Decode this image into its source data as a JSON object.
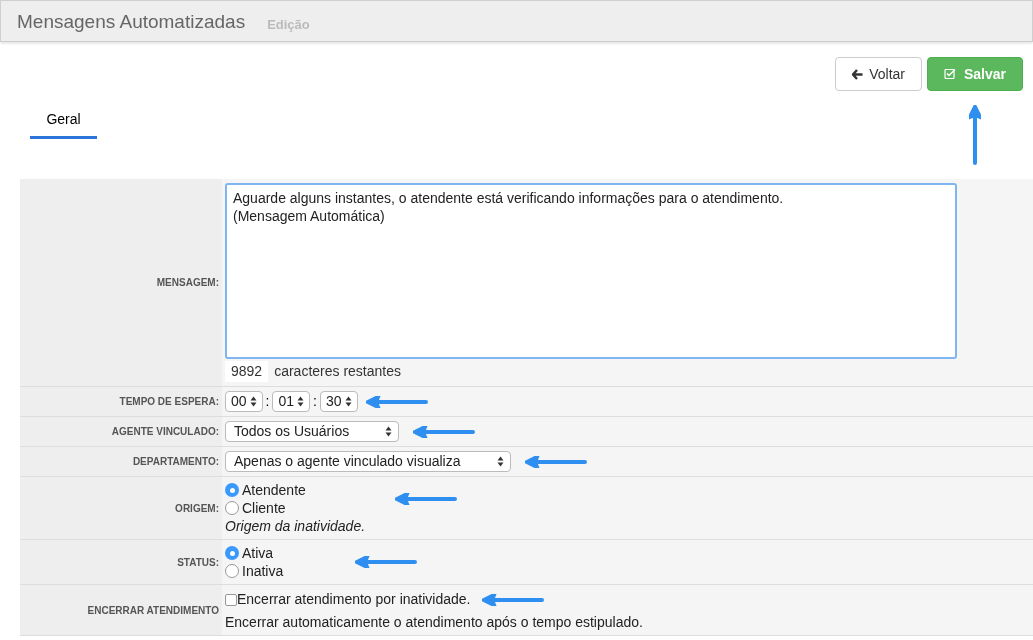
{
  "header": {
    "title": "Mensagens Automatizadas",
    "subtitle": "Edição"
  },
  "buttons": [
    {
      "label": "Voltar",
      "kind": "back"
    },
    {
      "label": "Salvar",
      "kind": "save"
    }
  ],
  "tabs": [
    {
      "label": "Geral",
      "selected": true
    }
  ],
  "form": [
    {
      "kind": "textarea",
      "label": "MENSAGEM:",
      "value": "Aguarde alguns instantes, o atendente está verificando informações para o atendimento.\n(Mensagem Automática)",
      "counter": "9892",
      "counter_text": "caracteres restantes"
    },
    {
      "kind": "time",
      "label": "TEMPO DE ESPERA:",
      "parts": [
        "00",
        "01",
        "30"
      ],
      "separator": ":"
    },
    {
      "kind": "select",
      "label": "AGENTE VINCULADO:",
      "value": "Todos os Usuários"
    },
    {
      "kind": "select",
      "label": "DEPARTAMENTO:",
      "value": "Apenas o agente vinculado visualiza"
    },
    {
      "kind": "radio",
      "label": "ORIGEM:",
      "options": [
        {
          "label": "Atendente",
          "selected": true
        },
        {
          "label": "Cliente",
          "selected": false
        }
      ],
      "hint": "Origem da inatividade."
    },
    {
      "kind": "radio",
      "label": "STATUS:",
      "options": [
        {
          "label": "Ativa",
          "selected": true
        },
        {
          "label": "Inativa",
          "selected": false
        }
      ]
    },
    {
      "kind": "checkbox",
      "label": "ENCERRAR ATENDIMENTO",
      "option": {
        "label": "Encerrar atendimento por inatividade.",
        "checked": false
      },
      "hint": "Encerrar automaticamente o atendimento após o tempo estipulado."
    }
  ]
}
